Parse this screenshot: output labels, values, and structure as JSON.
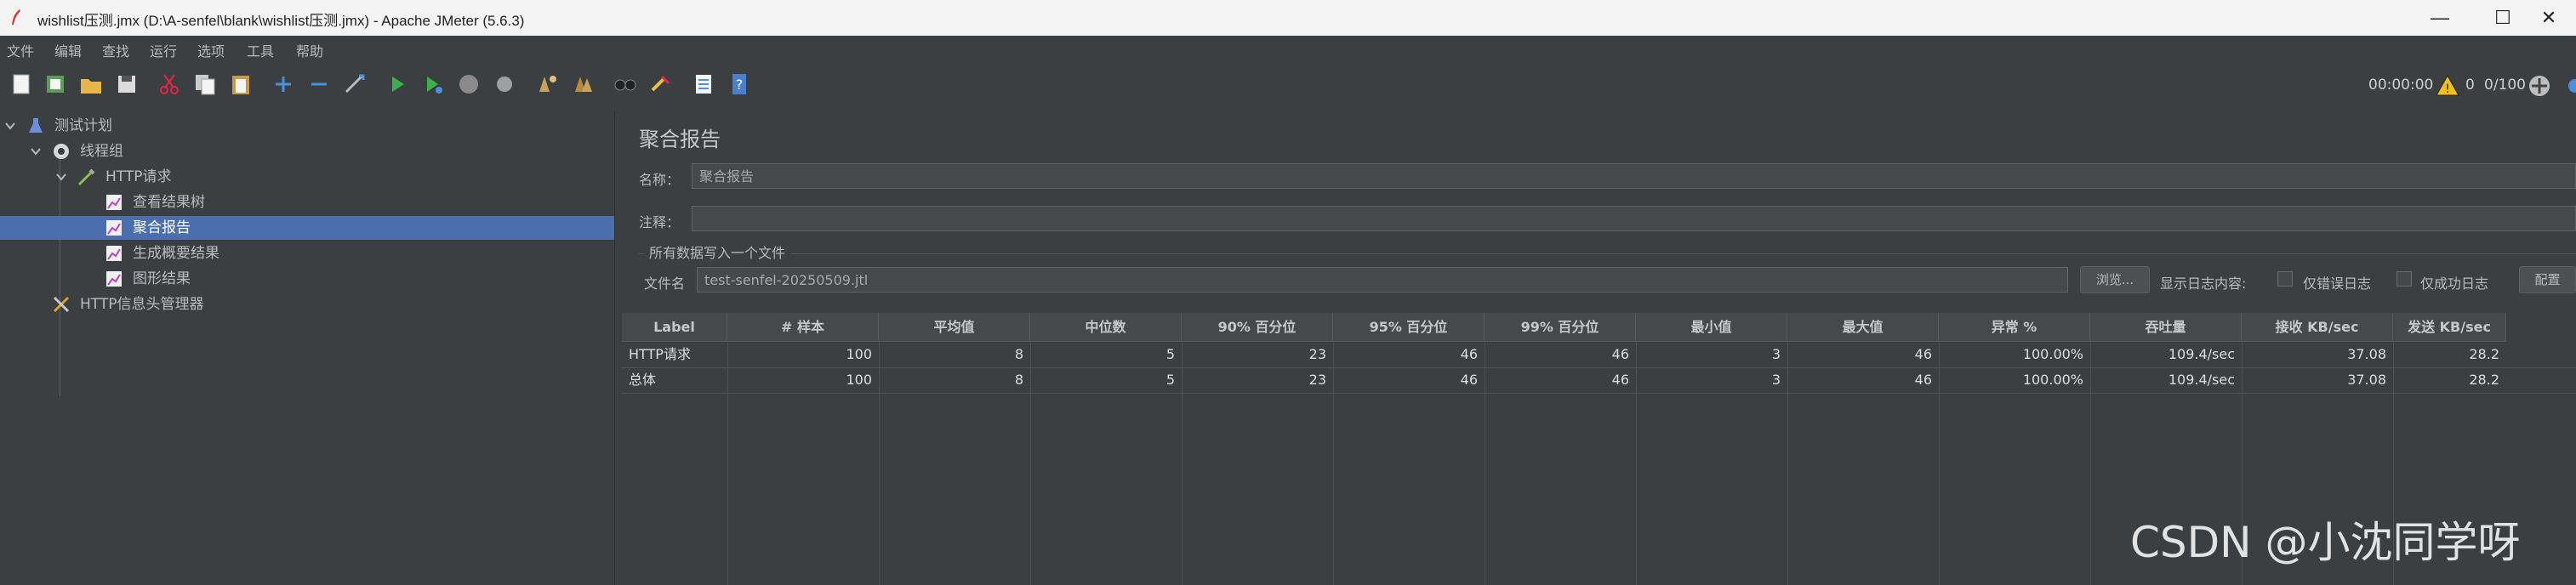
{
  "window": {
    "title": "wishlist压测.jmx (D:\\A-senfel\\blank\\wishlist压测.jmx) - Apache JMeter (5.6.3)",
    "minimize": "—",
    "maximize": "☐",
    "close": "✕"
  },
  "menu": [
    "文件",
    "编辑",
    "查找",
    "运行",
    "选项",
    "工具",
    "帮助"
  ],
  "toolbar": {
    "icons": [
      "new-icon",
      "templates-icon",
      "open-icon",
      "save-icon",
      "cut-icon",
      "copy-icon",
      "paste-icon",
      "expand-icon",
      "collapse-icon",
      "toggle-icon",
      "start-icon",
      "start-no-pause-icon",
      "stop-icon",
      "shutdown-icon",
      "clear-icon",
      "clear-all-icon",
      "search-icon",
      "reset-search-icon",
      "function-helper-icon",
      "help-icon"
    ],
    "timer": "00:00:00",
    "warning_count": "0",
    "threads": "0/100"
  },
  "tree": [
    {
      "label": "测试计划",
      "icon": "flask-icon"
    },
    {
      "label": "线程组",
      "icon": "gear-icon"
    },
    {
      "label": "HTTP请求",
      "icon": "pipette-icon"
    },
    {
      "label": "查看结果树",
      "icon": "chart-listener-icon"
    },
    {
      "label": "聚合报告",
      "icon": "chart-listener-icon",
      "selected": true
    },
    {
      "label": "生成概要结果",
      "icon": "chart-listener-icon"
    },
    {
      "label": "图形结果",
      "icon": "chart-listener-icon"
    },
    {
      "label": "HTTP信息头管理器",
      "icon": "tools-icon"
    }
  ],
  "panel": {
    "title": "聚合报告",
    "name_label": "名称：",
    "name_value": "聚合报告",
    "comment_label": "注释：",
    "comment_value": "",
    "group_title": "所有数据写入一个文件",
    "file_label": "文件名",
    "file_value": "test-senfel-20250509.jtl",
    "browse": "浏览...",
    "log_display": "显示日志内容:",
    "errors_only": "仅错误日志",
    "success_only": "仅成功日志",
    "configure": "配置"
  },
  "table": {
    "headers": [
      "Label",
      "# 样本",
      "平均值",
      "中位数",
      "90% 百分位",
      "95% 百分位",
      "99% 百分位",
      "最小值",
      "最大值",
      "异常 %",
      "吞吐量",
      "接收 KB/sec",
      "发送 KB/sec"
    ],
    "rows": [
      [
        "HTTP请求",
        "100",
        "8",
        "5",
        "23",
        "46",
        "46",
        "3",
        "46",
        "100.00%",
        "109.4/sec",
        "37.08",
        "28.2"
      ],
      [
        "总体",
        "100",
        "8",
        "5",
        "23",
        "46",
        "46",
        "3",
        "46",
        "100.00%",
        "109.4/sec",
        "37.08",
        "28.2"
      ]
    ]
  },
  "watermark": "CSDN @小沈同学呀"
}
